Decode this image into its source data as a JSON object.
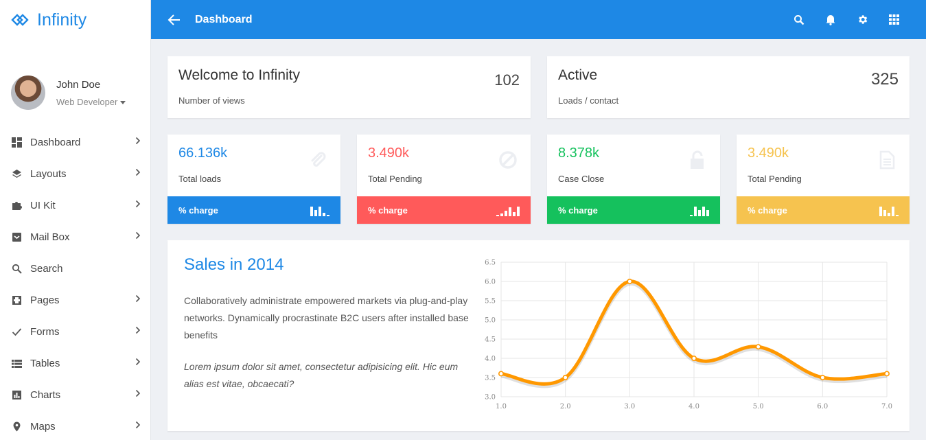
{
  "brand": {
    "name": "Infinity"
  },
  "user": {
    "name": "John Doe",
    "role": "Web Developer"
  },
  "nav": [
    {
      "label": "Dashboard",
      "icon": "dashboard-icon",
      "arrow": true
    },
    {
      "label": "Layouts",
      "icon": "layers-icon",
      "arrow": true
    },
    {
      "label": "UI Kit",
      "icon": "puzzle-icon",
      "arrow": true
    },
    {
      "label": "Mail Box",
      "icon": "inbox-icon",
      "arrow": true
    },
    {
      "label": "Search",
      "icon": "search-icon",
      "arrow": false
    },
    {
      "label": "Pages",
      "icon": "pages-icon",
      "arrow": true
    },
    {
      "label": "Forms",
      "icon": "check-icon",
      "arrow": true
    },
    {
      "label": "Tables",
      "icon": "table-icon",
      "arrow": true
    },
    {
      "label": "Charts",
      "icon": "bar-chart-icon",
      "arrow": true
    },
    {
      "label": "Maps",
      "icon": "map-pin-icon",
      "arrow": true
    }
  ],
  "topbar": {
    "title": "Dashboard"
  },
  "info_cards": [
    {
      "title": "Welcome to Infinity",
      "subtitle": "Number of views",
      "number": "102"
    },
    {
      "title": "Active",
      "subtitle": "Loads / contact",
      "number": "325"
    }
  ],
  "stat_cards": [
    {
      "value": "66.136k",
      "label": "Total loads",
      "footer": "% charge",
      "color": "#1e88e5",
      "icon": "paperclip-icon"
    },
    {
      "value": "3.490k",
      "label": "Total Pending",
      "footer": "% charge",
      "color": "#ff5a5a",
      "icon": "block-icon"
    },
    {
      "value": "8.378k",
      "label": "Case Close",
      "footer": "% charge",
      "color": "#15c15d",
      "icon": "unlock-icon"
    },
    {
      "value": "3.490k",
      "label": "Total Pending",
      "footer": "% charge",
      "color": "#f6c34f",
      "icon": "document-icon"
    }
  ],
  "sales": {
    "title": "Sales in 2014",
    "paragraph": "Collaboratively administrate empowered markets via plug-and-play networks. Dynamically procrastinate B2C users after installed base benefits",
    "quote": "Lorem ipsum dolor sit amet, consectetur adipisicing elit. Hic eum alias est vitae, obcaecati?"
  },
  "chart_data": {
    "type": "line",
    "x": [
      1.0,
      2.0,
      3.0,
      4.0,
      5.0,
      6.0,
      7.0
    ],
    "values": [
      3.6,
      3.5,
      6.0,
      4.0,
      4.3,
      3.5,
      3.6
    ],
    "xticks": [
      "1.0",
      "2.0",
      "3.0",
      "4.0",
      "5.0",
      "6.0",
      "7.0"
    ],
    "yticks": [
      "3.0",
      "3.5",
      "4.0",
      "4.5",
      "5.0",
      "5.5",
      "6.0",
      "6.5"
    ],
    "xlim": [
      1,
      7
    ],
    "ylim": [
      3,
      6.5
    ],
    "color": "#ff9800",
    "grid": true,
    "smooth": true
  }
}
